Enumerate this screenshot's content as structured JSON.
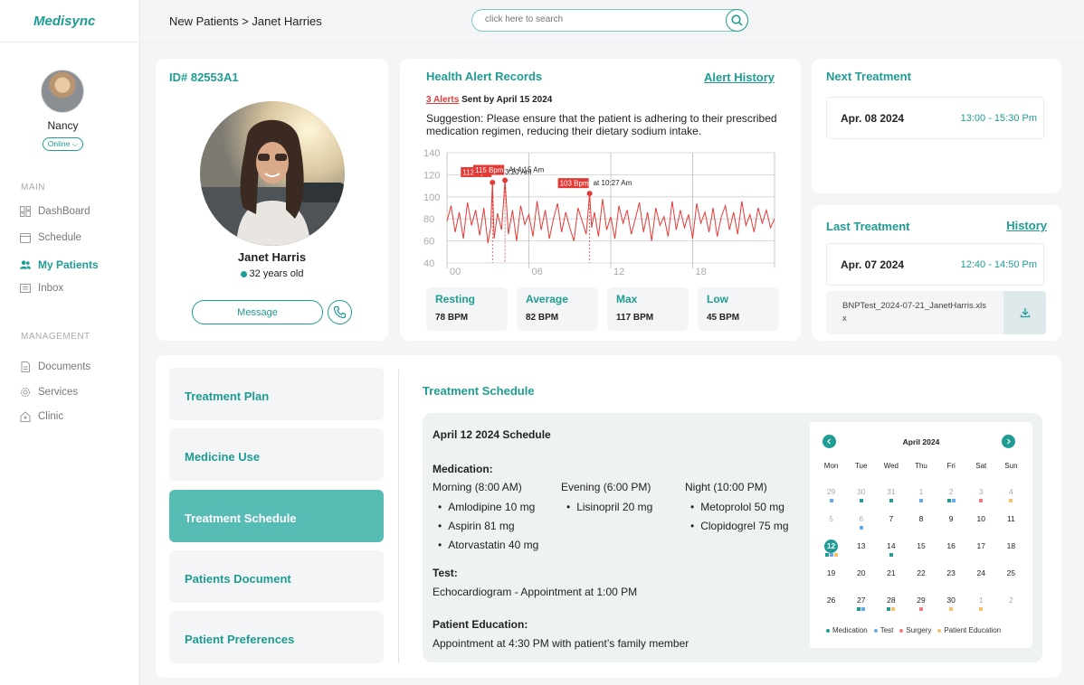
{
  "app": {
    "logo": "Medisync"
  },
  "user": {
    "name": "Nancy",
    "status": "Online"
  },
  "nav": {
    "main_label": "MAIN",
    "main_items": [
      {
        "label": "DashBoard",
        "icon": "dashboard-icon"
      },
      {
        "label": "Schedule",
        "icon": "calendar-icon"
      },
      {
        "label": "My Patients",
        "icon": "patients-icon",
        "active": true
      },
      {
        "label": "Inbox",
        "icon": "inbox-icon"
      }
    ],
    "management_label": "MANAGEMENT",
    "management_items": [
      {
        "label": "Documents",
        "icon": "document-icon"
      },
      {
        "label": "Services",
        "icon": "gear-icon"
      },
      {
        "label": "Clinic",
        "icon": "clinic-icon"
      }
    ]
  },
  "header": {
    "breadcrumb": "New Patients > Janet Harries",
    "search_placeholder": "click here to search"
  },
  "patient": {
    "id": "ID# 82553A1",
    "name": "Janet Harris",
    "age": "32 years old",
    "message_label": "Message"
  },
  "alerts": {
    "title": "Health Alert Records",
    "history_link": "Alert History",
    "count": "3 Alerts",
    "sent_by": "Sent by April 15 2024",
    "suggestion": "Suggestion: Please ensure that the patient is adhering to their prescribed medication regimen, reducing their dietary sodium intake.",
    "markers": [
      {
        "bpm": "113 Bpm",
        "time": "At 3:20 Am"
      },
      {
        "bpm": "115 Bpm",
        "time": "At 4:15 Am"
      },
      {
        "bpm": "103 Bpm",
        "time": "at 10:27 Am"
      }
    ],
    "stats": [
      {
        "label": "Resting",
        "value": "78 BPM"
      },
      {
        "label": "Average",
        "value": "82 BPM"
      },
      {
        "label": "Max",
        "value": "117 BPM"
      },
      {
        "label": "Low",
        "value": "45 BPM"
      }
    ]
  },
  "chart_data": {
    "type": "line",
    "title": "",
    "xlabel": "",
    "ylabel": "",
    "x_ticks": [
      "00",
      "06",
      "12",
      "18"
    ],
    "y_ticks": [
      40,
      60,
      80,
      100,
      120,
      140
    ],
    "ylim": [
      40,
      140
    ],
    "xlim": [
      0,
      24
    ],
    "grid": true,
    "color": "#e53935",
    "series": [
      {
        "x": [
          0,
          0.3,
          0.6,
          0.9,
          1.2,
          1.5,
          1.8,
          2.1,
          2.4,
          2.7,
          3.0,
          3.2,
          3.333,
          3.45,
          3.7,
          4.0,
          4.25,
          4.5,
          4.8,
          5.1,
          5.4,
          5.7,
          6.0,
          6.3,
          6.6,
          6.9,
          7.2,
          7.5,
          7.8,
          8.1,
          8.4,
          8.7,
          9.0,
          9.3,
          9.6,
          9.9,
          10.2,
          10.45,
          10.6,
          10.8,
          11.1,
          11.4,
          11.7,
          12.0,
          12.3,
          12.6,
          12.9,
          13.2,
          13.5,
          13.8,
          14.1,
          14.4,
          14.7,
          15.0,
          15.3,
          15.6,
          15.9,
          16.2,
          16.5,
          16.8,
          17.1,
          17.4,
          17.7,
          18.0,
          18.3,
          18.6,
          18.9,
          19.2,
          19.5,
          19.8,
          20.1,
          20.4,
          20.7,
          21.0,
          21.3,
          21.6,
          21.9,
          22.2,
          22.5,
          22.8,
          23.1,
          23.4,
          23.7,
          24.0
        ],
        "y": [
          78,
          92,
          68,
          86,
          62,
          95,
          74,
          88,
          65,
          90,
          58,
          72,
          113,
          62,
          85,
          70,
          115,
          66,
          88,
          60,
          92,
          75,
          84,
          64,
          96,
          70,
          88,
          62,
          80,
          94,
          68,
          86,
          72,
          60,
          90,
          78,
          66,
          103,
          72,
          86,
          64,
          98,
          70,
          82,
          62,
          92,
          76,
          88,
          66,
          80,
          95,
          68,
          86,
          60,
          90,
          74,
          82,
          64,
          96,
          70,
          88,
          72,
          84,
          62,
          94,
          76,
          86,
          68,
          90,
          64,
          82,
          92,
          70,
          86,
          66,
          96,
          74,
          84,
          68,
          90,
          76,
          88,
          72,
          80
        ]
      }
    ]
  },
  "next_treatment": {
    "title": "Next Treatment",
    "date": "Apr. 08 2024",
    "time": "13:00 - 15:30 Pm"
  },
  "last_treatment": {
    "title": "Last Treatment",
    "history_link": "History",
    "date": "Apr. 07 2024",
    "time": "12:40 - 14:50 Pm",
    "file": "BNPTest_2024-07-21_JanetHarris.xlsx"
  },
  "tabs": [
    {
      "label": "Treatment Plan"
    },
    {
      "label": "Medicine Use"
    },
    {
      "label": "Treatment Schedule",
      "active": true
    },
    {
      "label": "Patients Document"
    },
    {
      "label": "Patient Preferences"
    }
  ],
  "schedule": {
    "title": "Treatment Schedule",
    "heading": "April 12 2024 Schedule",
    "medication_label": "Medication:",
    "morning": {
      "label": "Morning (8:00 AM)",
      "items": [
        "Amlodipine 10 mg",
        "Aspirin 81 mg",
        "Atorvastatin 40 mg"
      ]
    },
    "evening": {
      "label": "Evening (6:00 PM)",
      "items": [
        "Lisinopril 20 mg"
      ]
    },
    "night": {
      "label": "Night (10:00 PM)",
      "items": [
        "Metoprolol 50 mg",
        "Clopidogrel 75 mg"
      ]
    },
    "test_label": "Test:",
    "test_text": "Echocardiogram - Appointment at 1:00 PM",
    "education_label": "Patient Education:",
    "education_text": "Appointment at 4:30 PM with patient’s family member"
  },
  "calendar": {
    "month": "April 2024",
    "weekdays": [
      "Mon",
      "Tue",
      "Wed",
      "Thu",
      "Fri",
      "Sat",
      "Sun"
    ],
    "colors": {
      "medication": "#1f9c93",
      "test": "#6aa9e9",
      "surgery": "#f07b82",
      "education": "#f5c26b"
    },
    "days": [
      {
        "d": "29",
        "muted": true,
        "dots": [
          "test"
        ]
      },
      {
        "d": "30",
        "muted": true,
        "dots": [
          "medication"
        ]
      },
      {
        "d": "31",
        "muted": true,
        "dots": [
          "medication"
        ]
      },
      {
        "d": "1",
        "muted": true,
        "dots": [
          "test"
        ]
      },
      {
        "d": "2",
        "muted": true,
        "dots": [
          "medication",
          "test"
        ]
      },
      {
        "d": "3",
        "muted": true,
        "dots": [
          "surgery"
        ]
      },
      {
        "d": "4",
        "muted": true,
        "dots": [
          "education"
        ]
      },
      {
        "d": "5",
        "muted": true,
        "dots": []
      },
      {
        "d": "6",
        "muted": true,
        "dots": [
          "test"
        ]
      },
      {
        "d": "7",
        "dots": []
      },
      {
        "d": "8",
        "dots": []
      },
      {
        "d": "9",
        "dots": []
      },
      {
        "d": "10",
        "dots": []
      },
      {
        "d": "11",
        "dots": []
      },
      {
        "d": "12",
        "today": true,
        "dots": [
          "medication",
          "test",
          "education"
        ]
      },
      {
        "d": "13",
        "dots": []
      },
      {
        "d": "14",
        "dots": [
          "medication"
        ]
      },
      {
        "d": "15",
        "dots": []
      },
      {
        "d": "16",
        "dots": []
      },
      {
        "d": "17",
        "dots": []
      },
      {
        "d": "18",
        "dots": []
      },
      {
        "d": "19",
        "dots": []
      },
      {
        "d": "20",
        "dots": []
      },
      {
        "d": "21",
        "dots": []
      },
      {
        "d": "22",
        "dots": []
      },
      {
        "d": "23",
        "dots": []
      },
      {
        "d": "24",
        "dots": []
      },
      {
        "d": "25",
        "dots": []
      },
      {
        "d": "26",
        "dots": []
      },
      {
        "d": "27",
        "dots": [
          "medication",
          "test"
        ]
      },
      {
        "d": "28",
        "dots": [
          "medication",
          "education"
        ]
      },
      {
        "d": "29",
        "dots": [
          "surgery"
        ]
      },
      {
        "d": "30",
        "dots": [
          "education"
        ]
      },
      {
        "d": "1",
        "muted": true,
        "dots": [
          "education"
        ]
      },
      {
        "d": "2",
        "muted": true,
        "dots": []
      }
    ],
    "legend": [
      {
        "key": "medication",
        "label": "Medication"
      },
      {
        "key": "test",
        "label": "Test"
      },
      {
        "key": "surgery",
        "label": "Surgery"
      },
      {
        "key": "education",
        "label": "Patient Education"
      }
    ]
  }
}
